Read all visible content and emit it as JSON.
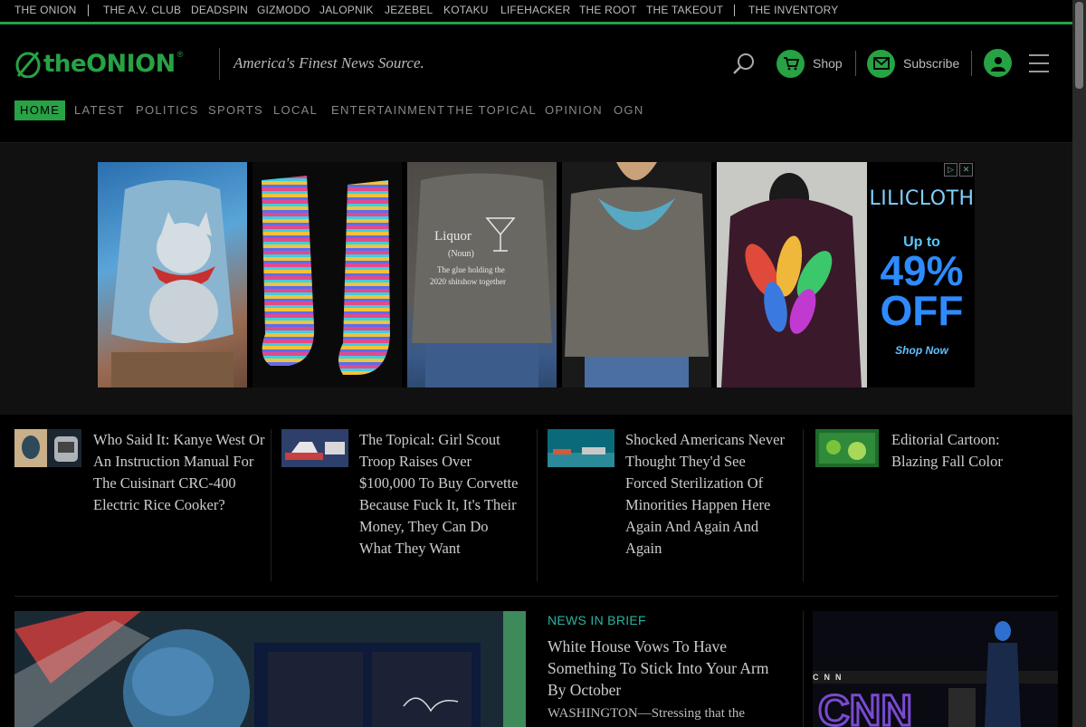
{
  "network": {
    "links": [
      "THE ONION",
      "THE A.V. CLUB",
      "DEADSPIN",
      "GIZMODO",
      "JALOPNIK",
      "JEZEBEL",
      "KOTAKU",
      "LIFEHACKER",
      "THE ROOT",
      "THE TAKEOUT",
      "THE INVENTORY"
    ]
  },
  "header": {
    "logo_the": "the",
    "logo_onion": "ONION",
    "logo_reg": "®",
    "tagline": "America's Finest News Source.",
    "shop_label": "Shop",
    "subscribe_label": "Subscribe"
  },
  "sections": {
    "items": [
      "HOME",
      "LATEST",
      "POLITICS",
      "SPORTS",
      "LOCAL",
      "ENTERTAINMENT",
      "THE TOPICAL",
      "OPINION",
      "OGN"
    ],
    "active": "HOME"
  },
  "ad": {
    "brand": "LILICLOTH",
    "up_to": "Up to",
    "percent": "49%",
    "off": "OFF",
    "cta": "Shop Now",
    "sweater_text_1": "Liquor",
    "sweater_text_2": "(Noun)",
    "sweater_text_3": "The glue holding the",
    "sweater_text_4": "2020 shitshow together"
  },
  "stories": [
    {
      "title": "Who Said It: Kanye West Or An Instruction Manual For The Cuisinart CRC-400 Electric Rice Cooker?"
    },
    {
      "title": "The Topical: Girl Scout Troop Raises Over $100,000 To Buy Corvette Because Fuck It, It's Their Money, They Can Do What They Want"
    },
    {
      "title": "Shocked Americans Never Thought They'd See Forced Sterilization Of Minorities Happen Here Again And Again And Again"
    },
    {
      "title": "Editorial Cartoon: Blazing Fall Color"
    }
  ],
  "brief": {
    "kicker": "NEWS IN BRIEF",
    "title": "White House Vows To Have Something To Stick Into Your Arm By October",
    "body": "WASHINGTON—Stressing that the"
  },
  "side": {
    "cnn": "CNN",
    "cnn_small": "CNN"
  },
  "colors": {
    "accent": "#27a244",
    "background": "#000000",
    "kicker": "#2bb3a0"
  }
}
